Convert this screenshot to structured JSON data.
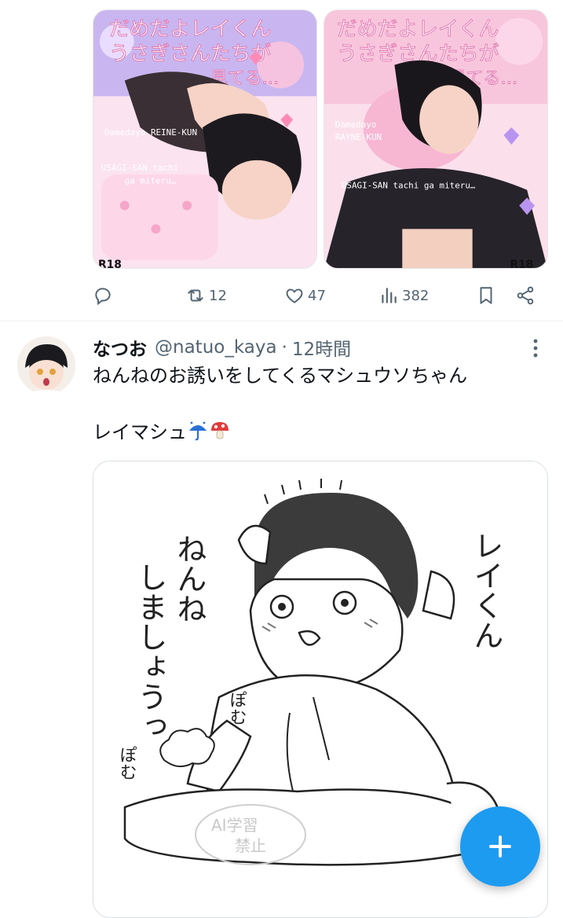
{
  "tweet_prev": {
    "media": [
      {
        "title_lines": [
          "だめだよレイくん",
          "うさぎさんたちが",
          "見てる…"
        ],
        "subtitle_lines": [
          "Damedayo REINE-KUN",
          "USAGI-SAN tachi",
          "ga miteru…"
        ],
        "badge": "R18"
      },
      {
        "title_lines": [
          "だめだよレイくん",
          "うさぎさんたちが",
          "見てる…"
        ],
        "subtitle_lines": [
          "Damedayo",
          "RAYNE-KUN",
          "USAGI-SAN tachi ga miteru…"
        ],
        "badge": "R18"
      }
    ],
    "actions": {
      "reply_icon": "reply-icon",
      "retweet_count": "12",
      "like_count": "47",
      "views_count": "382",
      "bookmark_icon": "bookmark-icon",
      "share_icon": "share-icon"
    }
  },
  "tweet": {
    "display_name": "なつお",
    "handle": "@natuo_kaya",
    "separator": "·",
    "time": "12時間",
    "text_line1": "ねんねのお誘いをしてくるマシュウソちゃん",
    "text_line2": "レイマシュ",
    "media": {
      "hand_text_1": "ねんね",
      "hand_text_2": "しましょうっ",
      "hand_text_3": "レイくん",
      "sfx_1": "ぽむ",
      "sfx_2": "ぽむ",
      "watermark_line1": "AI学習",
      "watermark_line2": "禁止"
    }
  },
  "fab": {
    "icon": "plus-icon"
  },
  "colors": {
    "accent": "#1d9bf0",
    "muted": "#536471",
    "text": "#0f1419"
  }
}
